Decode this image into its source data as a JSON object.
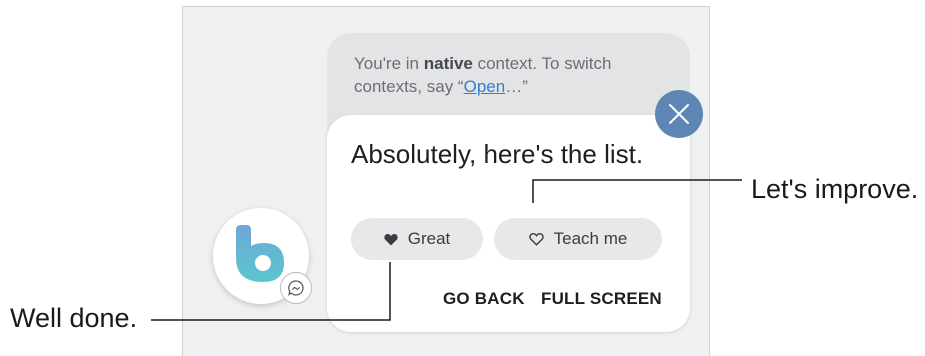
{
  "context_message": {
    "prefix": "You're in ",
    "bold_word": "native",
    "middle": " context. To switch contexts, say “",
    "link": "Open",
    "suffix": "…”"
  },
  "response": {
    "text": "Absolutely, here's the list."
  },
  "feedback": {
    "great_label": "Great",
    "teach_label": "Teach me"
  },
  "actions": {
    "go_back": "GO BACK",
    "full_screen": "FULL SCREEN"
  },
  "callouts": {
    "right": "Let's improve.",
    "left": "Well done."
  },
  "colors": {
    "accent_link": "#2f7fd1",
    "close_button": "#5d86b5",
    "bixby_logo_top": "#6ea6d8",
    "bixby_logo_bottom": "#5bc6cf"
  },
  "icons": {
    "close": "close-icon",
    "great": "heart-filled-icon",
    "teach": "heart-outline-icon",
    "badge": "conversation-icon",
    "assistant": "bixby-logo-icon"
  }
}
